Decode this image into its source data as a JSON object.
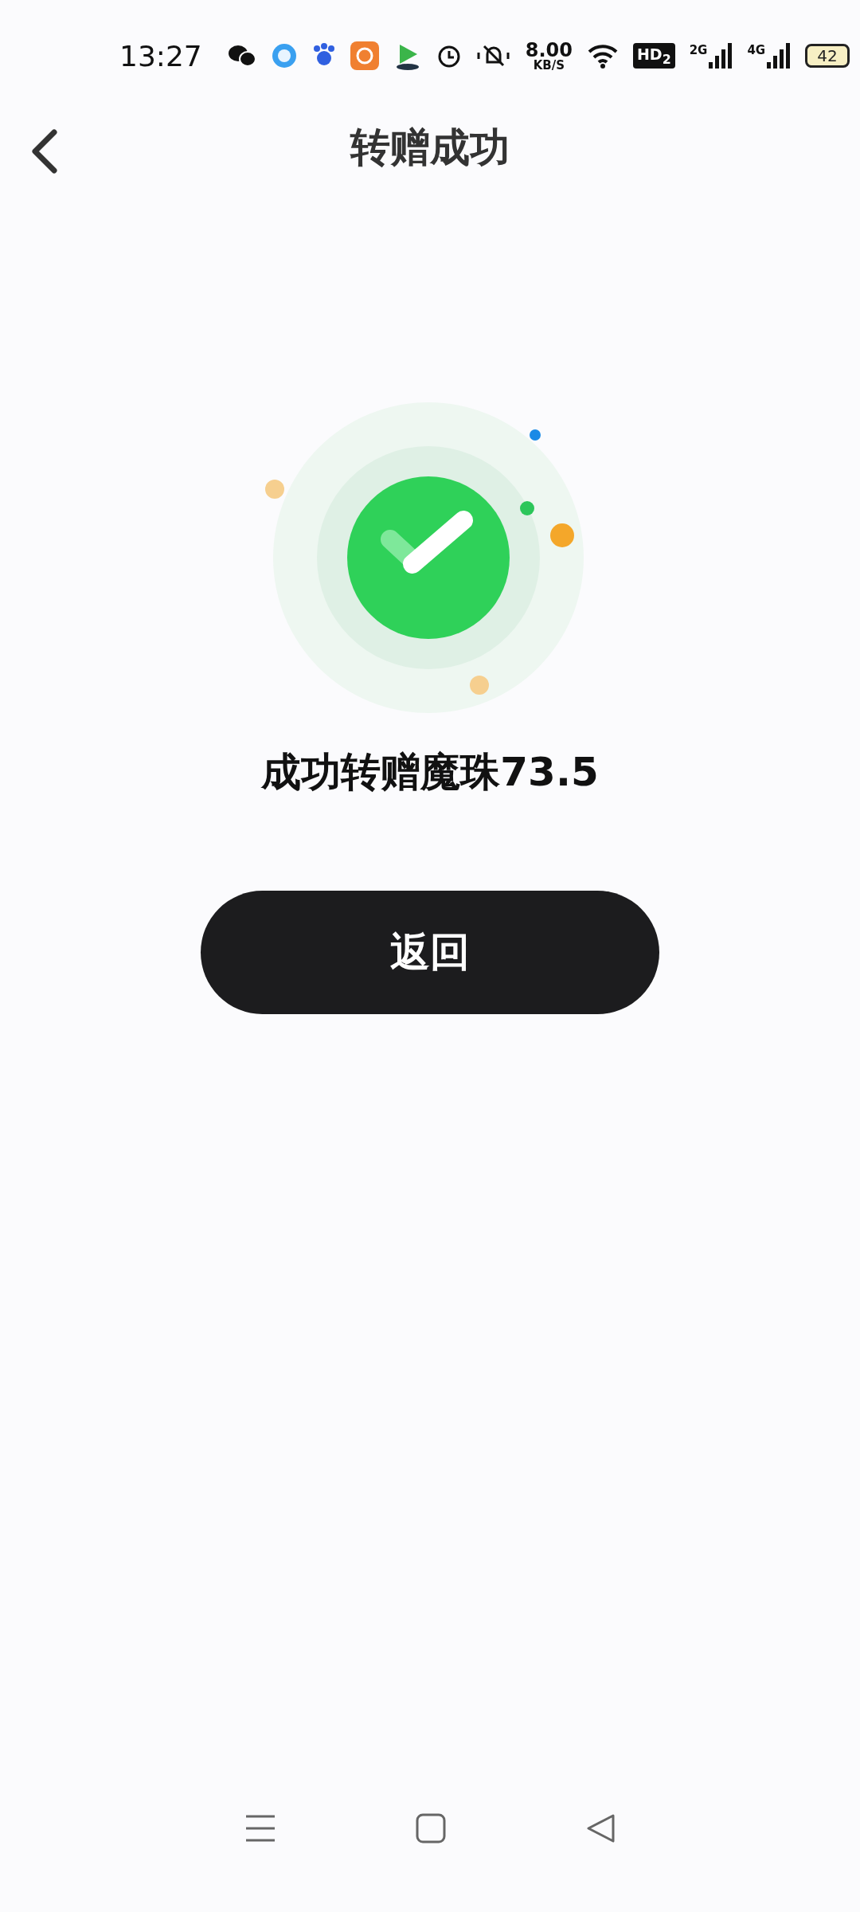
{
  "status_bar": {
    "time": "13:27",
    "net_speed": "8.00",
    "net_unit": "KB/S",
    "hd_badge": "HD$_{2}$",
    "signals": [
      {
        "label": "2G"
      },
      {
        "label": "4G"
      }
    ],
    "battery": "42"
  },
  "header": {
    "title": "转赠成功"
  },
  "result": {
    "message": "成功转赠魔珠73.5"
  },
  "button": {
    "label": "返回"
  }
}
